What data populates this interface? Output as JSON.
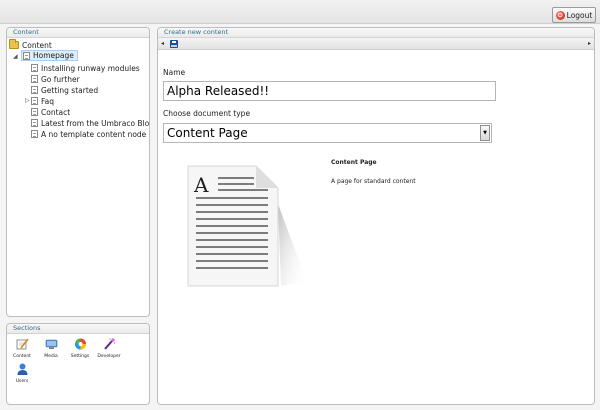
{
  "header": {
    "logout_label": "Logout"
  },
  "content_panel": {
    "title": "Content",
    "root_label": "Content",
    "homepage_label": "Homepage",
    "children": [
      "Installing runway modules",
      "Go further",
      "Getting started",
      "Faq",
      "Contact",
      "Latest from the Umbraco Blog",
      "A no template content node"
    ]
  },
  "sections_panel": {
    "title": "Sections",
    "items": [
      "Content",
      "Media",
      "Settings",
      "Developer",
      "Users"
    ]
  },
  "editor": {
    "title": "Create new content",
    "name_label": "Name",
    "name_value": "Alpha Released!!",
    "doctype_label": "Choose document type",
    "doctype_selected": "Content Page",
    "doctype_title": "Content Page",
    "doctype_description": "A page for standard content"
  },
  "preview": {
    "letter": "A"
  }
}
